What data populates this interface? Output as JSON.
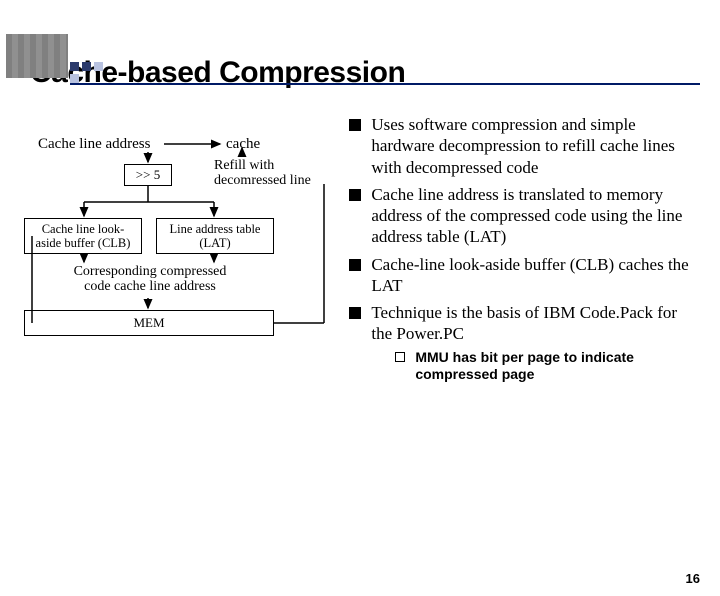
{
  "slide": {
    "title": "Cache-based Compression",
    "page_number": "16"
  },
  "bullets": [
    "Uses software compression and simple hardware decompression to refill cache lines with decompressed code",
    "Cache line address is translated to memory address of the compressed code using the line address table (LAT)",
    "Cache-line look-aside buffer (CLB) caches the LAT",
    "Technique is the basis of IBM Code.Pack for the Power.PC"
  ],
  "sub_bullet": "MMU has bit per page to indicate compressed page",
  "diagram": {
    "cache_line_address": "Cache line address",
    "cache": "cache",
    "shift": ">> 5",
    "refill": "Refill with decomressed line",
    "clb": "Cache line look-aside buffer (CLB)",
    "lat": "Line address table (LAT)",
    "corresponding": "Corresponding compressed code cache line address",
    "mem": "MEM"
  }
}
